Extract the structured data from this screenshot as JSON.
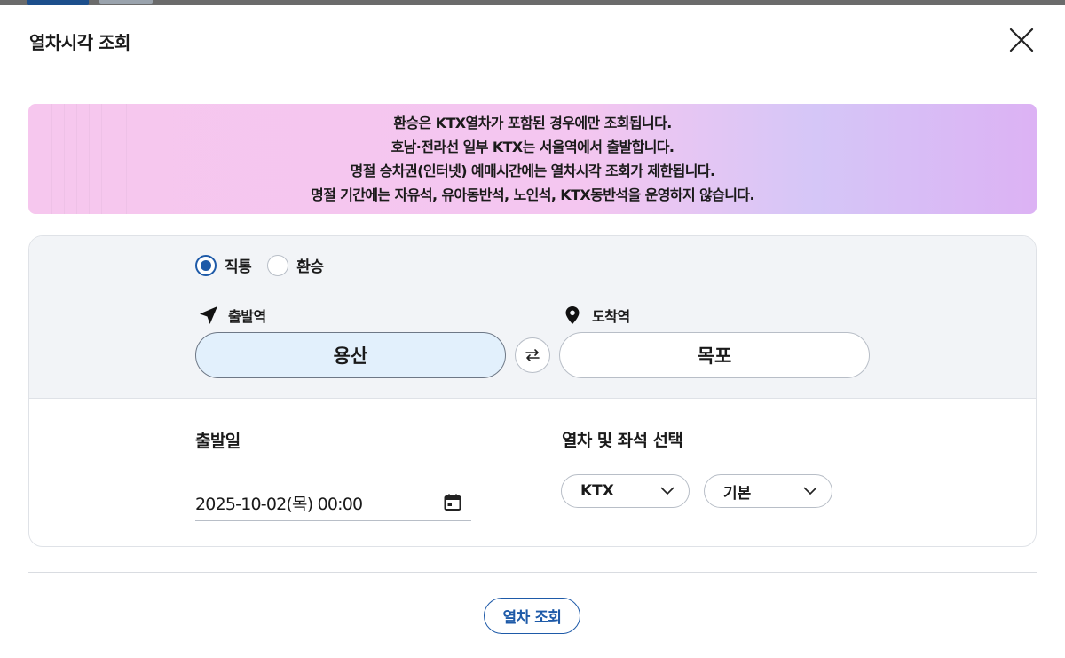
{
  "dialog": {
    "title": "열차시각 조회"
  },
  "notice": {
    "lines": [
      "환승은 KTX열차가 포함된 경우에만 조회됩니다.",
      "호남·전라선 일부 KTX는 서울역에서 출발합니다.",
      "명절 승차권(인터넷) 예매시간에는 열차시각 조회가 제한됩니다.",
      "명절 기간에는 자유석, 유아동반석, 노인석, KTX동반석을 운영하지 않습니다."
    ]
  },
  "route_type": {
    "options": [
      {
        "label": "직통",
        "checked": true
      },
      {
        "label": "환승",
        "checked": false
      }
    ]
  },
  "departure": {
    "label": "출발역",
    "station": "용산",
    "icon": "navigation-arrow-icon"
  },
  "arrival": {
    "label": "도착역",
    "station": "목포",
    "icon": "location-pin-icon"
  },
  "date": {
    "label": "출발일",
    "value": "2025-10-02(목) 00:00"
  },
  "train_seat": {
    "label": "열차 및 좌석 선택",
    "train": "KTX",
    "seat": "기본"
  },
  "search": {
    "label": "열차 조회"
  },
  "colors": {
    "accent": "#1e5aa8",
    "departure_bg": "#e2f0fc",
    "panel_bg": "#f2f4f7"
  }
}
